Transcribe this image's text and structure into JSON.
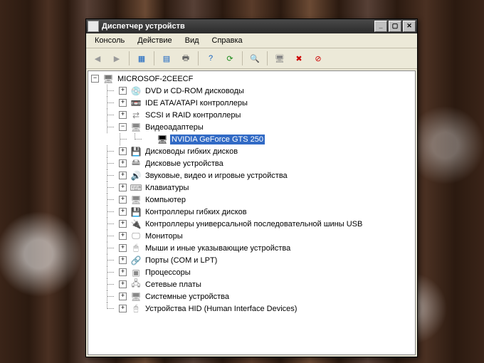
{
  "window": {
    "title": "Диспетчер устройств"
  },
  "menu": {
    "console": "Консоль",
    "action": "Действие",
    "view": "Вид",
    "help": "Справка"
  },
  "toolbar_icons": {
    "back": "back-icon",
    "forward": "forward-icon",
    "up": "up-icon",
    "show": "show-icon",
    "print": "print-icon",
    "help": "help-icon",
    "refresh": "refresh-icon",
    "scan": "scan-icon",
    "uninstall": "uninstall-icon",
    "disable": "disable-icon",
    "update": "update-icon"
  },
  "tree": {
    "root": "MICROSOF-2CEECF",
    "selected": "NVIDIA GeForce GTS 250",
    "nodes": [
      {
        "label": "DVD и CD-ROM дисководы",
        "icon": "💿",
        "expanded": false
      },
      {
        "label": "IDE ATA/ATAPI контроллеры",
        "icon": "📼",
        "expanded": false
      },
      {
        "label": "SCSI и RAID контроллеры",
        "icon": "⇄",
        "expanded": false
      },
      {
        "label": "Видеоадаптеры",
        "icon": "🖥",
        "expanded": true,
        "children": [
          {
            "label": "NVIDIA GeForce GTS 250",
            "icon": "🖥",
            "selected": true
          }
        ]
      },
      {
        "label": "Дисководы гибких дисков",
        "icon": "💾",
        "expanded": false
      },
      {
        "label": "Дисковые устройства",
        "icon": "🖴",
        "expanded": false
      },
      {
        "label": "Звуковые, видео и игровые устройства",
        "icon": "🔊",
        "expanded": false
      },
      {
        "label": "Клавиатуры",
        "icon": "⌨",
        "expanded": false
      },
      {
        "label": "Компьютер",
        "icon": "🖥",
        "expanded": false
      },
      {
        "label": "Контроллеры гибких дисков",
        "icon": "💾",
        "expanded": false
      },
      {
        "label": "Контроллеры универсальной последовательной шины USB",
        "icon": "🔌",
        "expanded": false
      },
      {
        "label": "Мониторы",
        "icon": "🖵",
        "expanded": false
      },
      {
        "label": "Мыши и иные указывающие устройства",
        "icon": "🖱",
        "expanded": false
      },
      {
        "label": "Порты (COM и LPT)",
        "icon": "🔗",
        "expanded": false
      },
      {
        "label": "Процессоры",
        "icon": "▣",
        "expanded": false
      },
      {
        "label": "Сетевые платы",
        "icon": "🖧",
        "expanded": false
      },
      {
        "label": "Системные устройства",
        "icon": "🖥",
        "expanded": false
      },
      {
        "label": "Устройства HID (Human Interface Devices)",
        "icon": "🖰",
        "expanded": false
      }
    ]
  }
}
